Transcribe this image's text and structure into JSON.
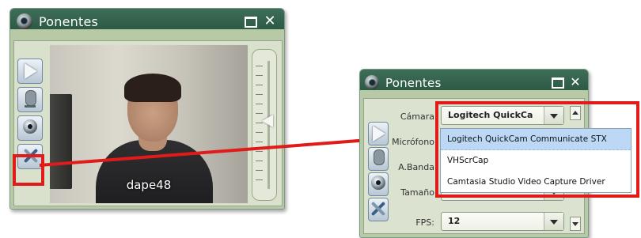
{
  "left_panel": {
    "title": "Ponentes",
    "video_label": "dape48"
  },
  "right_panel": {
    "title": "Ponentes",
    "fields": [
      {
        "label": "Cámara",
        "value": "Logitech QuickCam"
      },
      {
        "label": "Micrófono",
        "value": ""
      },
      {
        "label": "A.Banda",
        "value": ""
      },
      {
        "label": "Tamaño",
        "value": ""
      },
      {
        "label": "FPS:",
        "value": "12"
      }
    ],
    "dropdown_options": [
      "Logitech QuickCam Communicate STX",
      "VHScrCap",
      "Camtasia Studio Video Capture Driver"
    ],
    "selected_option": "Logitech QuickCam Communicate STX"
  },
  "icons": {
    "title": "webcam-icon",
    "play": "play-icon",
    "mic": "microphone-icon",
    "camera": "camera-icon",
    "settings": "tools-icon",
    "maximize": "maximize-icon",
    "close": "close-icon"
  },
  "colors": {
    "titlebar": "#2c5a45",
    "panel_body": "#b8c9a6",
    "highlight": "#e11a1a",
    "selection": "#bcd8f4"
  }
}
